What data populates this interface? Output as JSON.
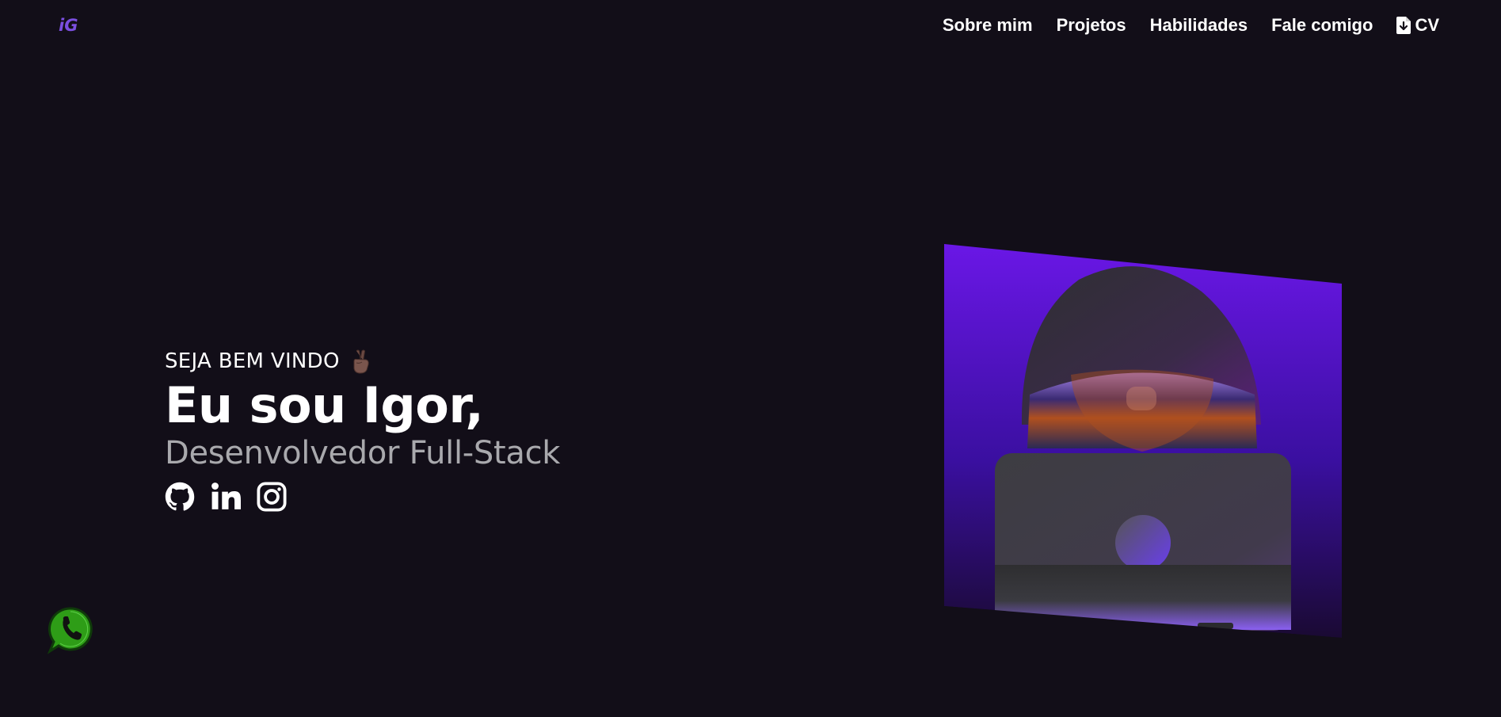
{
  "brand": {
    "logo_text": "iG"
  },
  "nav": {
    "items": [
      {
        "label": "Sobre mim"
      },
      {
        "label": "Projetos"
      },
      {
        "label": "Habilidades"
      },
      {
        "label": "Fale comigo"
      },
      {
        "label": "CV",
        "icon": "file-download-icon"
      }
    ]
  },
  "hero": {
    "welcome": "SEJA BEM VINDO",
    "welcome_emoji": "victory-hand-icon",
    "headline": "Eu sou Igor,",
    "subtitle": "Desenvolvedor Full-Stack",
    "socials": [
      {
        "icon": "github-icon"
      },
      {
        "icon": "linkedin-icon"
      },
      {
        "icon": "instagram-icon"
      }
    ]
  },
  "floating": {
    "icon": "whatsapp-icon"
  },
  "colors": {
    "background": "#120e18",
    "accent": "#7b4fe0",
    "subtitle": "#a9a9ad",
    "illustration_top": "#6a17e6",
    "illustration_bottom": "#1a0a33",
    "whatsapp": "#2e9d17"
  }
}
